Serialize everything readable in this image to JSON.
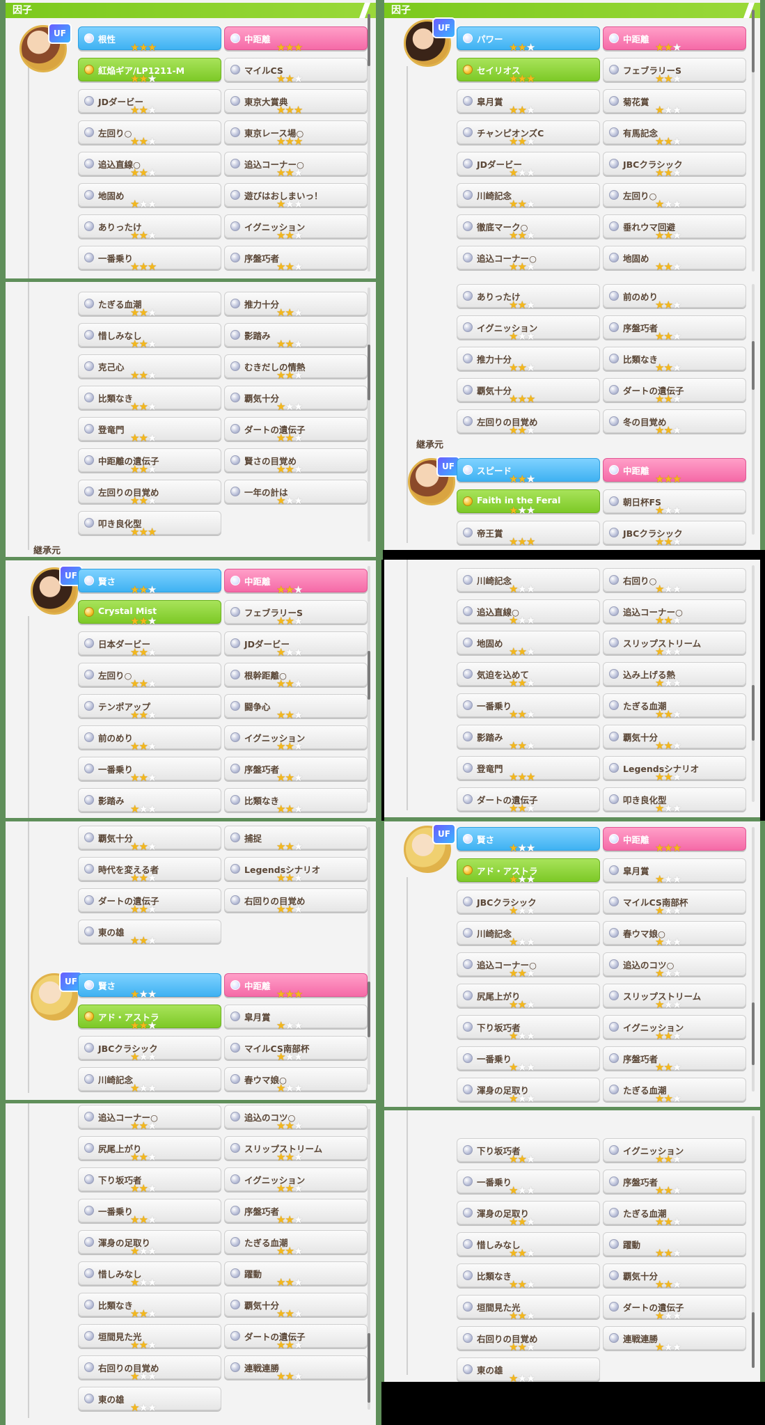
{
  "panel_title": "因子",
  "inherit_label": "継承元",
  "rank_badge": "UF",
  "panel1": {
    "left": [
      {
        "label": "根性",
        "stars": 3,
        "color": "blue"
      },
      {
        "label": "紅焔ギア/LP1211-M",
        "stars": 2,
        "color": "green"
      },
      {
        "label": "JDダービー",
        "stars": 2
      },
      {
        "label": "左回り○",
        "stars": 2
      },
      {
        "label": "追込直線○",
        "stars": 2
      },
      {
        "label": "地固め",
        "stars": 1
      },
      {
        "label": "ありったけ",
        "stars": 2
      },
      {
        "label": "一番乗り",
        "stars": 3
      }
    ],
    "right": [
      {
        "label": "中距離",
        "stars": 3,
        "color": "pink"
      },
      {
        "label": "マイルCS",
        "stars": 2
      },
      {
        "label": "東京大賞典",
        "stars": 3
      },
      {
        "label": "東京レース場○",
        "stars": 3
      },
      {
        "label": "追込コーナー○",
        "stars": 2
      },
      {
        "label": "遊びはおしまいっ！",
        "stars": 1
      },
      {
        "label": "イグニッション",
        "stars": 2
      },
      {
        "label": "序盤巧者",
        "stars": 2
      }
    ]
  },
  "panel2": {
    "left": [
      {
        "label": "パワー",
        "stars": 2,
        "color": "blue"
      },
      {
        "label": "セイリオス",
        "stars": 3,
        "color": "green"
      },
      {
        "label": "皐月賞",
        "stars": 2
      },
      {
        "label": "チャンピオンズC",
        "stars": 2
      },
      {
        "label": "JDダービー",
        "stars": 1
      },
      {
        "label": "川崎記念",
        "stars": 2
      },
      {
        "label": "徹底マーク○",
        "stars": 2
      },
      {
        "label": "追込コーナー○",
        "stars": 2
      }
    ],
    "right": [
      {
        "label": "中距離",
        "stars": 2,
        "color": "pink"
      },
      {
        "label": "フェブラリーS",
        "stars": 2
      },
      {
        "label": "菊花賞",
        "stars": 1
      },
      {
        "label": "有馬記念",
        "stars": 2
      },
      {
        "label": "JBCクラシック",
        "stars": 2
      },
      {
        "label": "左回り○",
        "stars": 1
      },
      {
        "label": "垂れウマ回避",
        "stars": 2
      },
      {
        "label": "地固め",
        "stars": 2
      }
    ]
  },
  "panel3": {
    "left": [
      {
        "label": "たぎる血潮",
        "stars": 2
      },
      {
        "label": "惜しみなし",
        "stars": 2
      },
      {
        "label": "克己心",
        "stars": 2
      },
      {
        "label": "比類なき",
        "stars": 2
      },
      {
        "label": "登竜門",
        "stars": 2
      },
      {
        "label": "中距離の遺伝子",
        "stars": 2
      },
      {
        "label": "左回りの目覚め",
        "stars": 2
      },
      {
        "label": "叩き良化型",
        "stars": 3
      }
    ],
    "right": [
      {
        "label": "推力十分",
        "stars": 2
      },
      {
        "label": "影踏み",
        "stars": 2
      },
      {
        "label": "むきだしの情熱",
        "stars": 2
      },
      {
        "label": "覇気十分",
        "stars": 1
      },
      {
        "label": "ダートの遺伝子",
        "stars": 2
      },
      {
        "label": "賢さの目覚め",
        "stars": 2
      },
      {
        "label": "一年の計は",
        "stars": 1
      }
    ]
  },
  "panel4": {
    "rows_left": [
      {
        "label": "ありったけ",
        "stars": 2
      },
      {
        "label": "イグニッション",
        "stars": 1
      },
      {
        "label": "推力十分",
        "stars": 2
      },
      {
        "label": "覇気十分",
        "stars": 3
      },
      {
        "label": "左回りの目覚め",
        "stars": 2
      }
    ],
    "rows_right": [
      {
        "label": "前のめり",
        "stars": 2
      },
      {
        "label": "序盤巧者",
        "stars": 2
      },
      {
        "label": "比類なき",
        "stars": 2
      },
      {
        "label": "ダートの遺伝子",
        "stars": 2
      },
      {
        "label": "冬の目覚め",
        "stars": 2
      }
    ],
    "inherit_left": [
      {
        "label": "スピード",
        "stars": 2,
        "color": "blue"
      },
      {
        "label": "Faith in the Feral",
        "stars": 1,
        "color": "green"
      },
      {
        "label": "帝王賞",
        "stars": 3
      }
    ],
    "inherit_right": [
      {
        "label": "中距離",
        "stars": 3,
        "color": "pink"
      },
      {
        "label": "朝日杯FS",
        "stars": 1
      },
      {
        "label": "JBCクラシック",
        "stars": 2
      }
    ]
  },
  "panel5": {
    "left": [
      {
        "label": "賢さ",
        "stars": 2,
        "color": "blue"
      },
      {
        "label": "Crystal Mist",
        "stars": 2,
        "color": "green"
      },
      {
        "label": "日本ダービー",
        "stars": 2
      },
      {
        "label": "左回り○",
        "stars": 2
      },
      {
        "label": "テンポアップ",
        "stars": 2
      },
      {
        "label": "前のめり",
        "stars": 2
      },
      {
        "label": "一番乗り",
        "stars": 2
      },
      {
        "label": "影踏み",
        "stars": 1
      }
    ],
    "right": [
      {
        "label": "中距離",
        "stars": 2,
        "color": "pink"
      },
      {
        "label": "フェブラリーS",
        "stars": 2
      },
      {
        "label": "JDダービー",
        "stars": 1
      },
      {
        "label": "根幹距離○",
        "stars": 2
      },
      {
        "label": "闘争心",
        "stars": 2
      },
      {
        "label": "イグニッション",
        "stars": 2
      },
      {
        "label": "序盤巧者",
        "stars": 2
      },
      {
        "label": "比類なき",
        "stars": 2
      }
    ]
  },
  "panel6": {
    "left": [
      {
        "label": "川崎記念",
        "stars": 1
      },
      {
        "label": "追込直線○",
        "stars": 1
      },
      {
        "label": "地固め",
        "stars": 2
      },
      {
        "label": "気迫を込めて",
        "stars": 2
      },
      {
        "label": "一番乗り",
        "stars": 2
      },
      {
        "label": "影踏み",
        "stars": 2
      },
      {
        "label": "登竜門",
        "stars": 3
      },
      {
        "label": "ダートの遺伝子",
        "stars": 2
      }
    ],
    "right": [
      {
        "label": "右回り○",
        "stars": 1
      },
      {
        "label": "追込コーナー○",
        "stars": 2
      },
      {
        "label": "スリップストリーム",
        "stars": 1
      },
      {
        "label": "込み上げる熱",
        "stars": 1
      },
      {
        "label": "たぎる血潮",
        "stars": 2
      },
      {
        "label": "覇気十分",
        "stars": 2
      },
      {
        "label": "Legendsシナリオ",
        "stars": 2
      },
      {
        "label": "叩き良化型",
        "stars": 1
      }
    ]
  },
  "panel7": {
    "top_left": [
      {
        "label": "覇気十分",
        "stars": 2
      },
      {
        "label": "時代を変える者",
        "stars": 2
      },
      {
        "label": "ダートの遺伝子",
        "stars": 2
      },
      {
        "label": "東の雄",
        "stars": 2
      }
    ],
    "top_right": [
      {
        "label": "捕捉",
        "stars": 2
      },
      {
        "label": "Legendsシナリオ",
        "stars": 2
      },
      {
        "label": "右回りの目覚め",
        "stars": 2
      }
    ],
    "left": [
      {
        "label": "賢さ",
        "stars": 1,
        "color": "blue"
      },
      {
        "label": "アド・アストラ",
        "stars": 2,
        "color": "green"
      },
      {
        "label": "JBCクラシック",
        "stars": 1
      },
      {
        "label": "川崎記念",
        "stars": 1
      }
    ],
    "right": [
      {
        "label": "中距離",
        "stars": 3,
        "color": "pink"
      },
      {
        "label": "皐月賞",
        "stars": 1
      },
      {
        "label": "マイルCS南部杯",
        "stars": 1
      },
      {
        "label": "春ウマ娘○",
        "stars": 1
      }
    ]
  },
  "panel8": {
    "left": [
      {
        "label": "賢さ",
        "stars": 1,
        "color": "blue"
      },
      {
        "label": "アド・アストラ",
        "stars": 1,
        "color": "green"
      },
      {
        "label": "JBCクラシック",
        "stars": 1
      },
      {
        "label": "川崎記念",
        "stars": 1
      },
      {
        "label": "追込コーナー○",
        "stars": 2
      },
      {
        "label": "尻尾上がり",
        "stars": 2
      },
      {
        "label": "下り坂巧者",
        "stars": 1
      },
      {
        "label": "一番乗り",
        "stars": 1
      },
      {
        "label": "渾身の足取り",
        "stars": 1
      }
    ],
    "right": [
      {
        "label": "中距離",
        "stars": 3,
        "color": "pink"
      },
      {
        "label": "皐月賞",
        "stars": 1
      },
      {
        "label": "マイルCS南部杯",
        "stars": 1
      },
      {
        "label": "春ウマ娘○",
        "stars": 1
      },
      {
        "label": "追込のコツ○",
        "stars": 1
      },
      {
        "label": "スリップストリーム",
        "stars": 1
      },
      {
        "label": "イグニッション",
        "stars": 2
      },
      {
        "label": "序盤巧者",
        "stars": 2
      },
      {
        "label": "たぎる血潮",
        "stars": 2
      }
    ]
  },
  "panel9": {
    "left": [
      {
        "label": "追込コーナー○",
        "stars": 2
      },
      {
        "label": "尻尾上がり",
        "stars": 2
      },
      {
        "label": "下り坂巧者",
        "stars": 2
      },
      {
        "label": "一番乗り",
        "stars": 2
      },
      {
        "label": "渾身の足取り",
        "stars": 1
      },
      {
        "label": "惜しみなし",
        "stars": 1
      },
      {
        "label": "比類なき",
        "stars": 2
      },
      {
        "label": "垣間見た光",
        "stars": 2
      },
      {
        "label": "右回りの目覚め",
        "stars": 1
      },
      {
        "label": "東の雄",
        "stars": 1
      }
    ],
    "right": [
      {
        "label": "追込のコツ○",
        "stars": 2
      },
      {
        "label": "スリップストリーム",
        "stars": 2
      },
      {
        "label": "イグニッション",
        "stars": 2
      },
      {
        "label": "序盤巧者",
        "stars": 2
      },
      {
        "label": "たぎる血潮",
        "stars": 2
      },
      {
        "label": "躍動",
        "stars": 2
      },
      {
        "label": "覇気十分",
        "stars": 2
      },
      {
        "label": "ダートの遺伝子",
        "stars": 2
      },
      {
        "label": "連戦連勝",
        "stars": 2
      }
    ]
  },
  "panel10": {
    "left": [
      {
        "label": "下り坂巧者",
        "stars": 2
      },
      {
        "label": "一番乗り",
        "stars": 1
      },
      {
        "label": "渾身の足取り",
        "stars": 2
      },
      {
        "label": "惜しみなし",
        "stars": 2
      },
      {
        "label": "比類なき",
        "stars": 2
      },
      {
        "label": "垣間見た光",
        "stars": 2
      },
      {
        "label": "右回りの目覚め",
        "stars": 2
      },
      {
        "label": "東の雄",
        "stars": 1
      }
    ],
    "right": [
      {
        "label": "イグニッション",
        "stars": 2
      },
      {
        "label": "序盤巧者",
        "stars": 2
      },
      {
        "label": "たぎる血潮",
        "stars": 2
      },
      {
        "label": "躍動",
        "stars": 2
      },
      {
        "label": "覇気十分",
        "stars": 2
      },
      {
        "label": "ダートの遺伝子",
        "stars": 1
      },
      {
        "label": "連戦連勝",
        "stars": 1
      }
    ]
  }
}
